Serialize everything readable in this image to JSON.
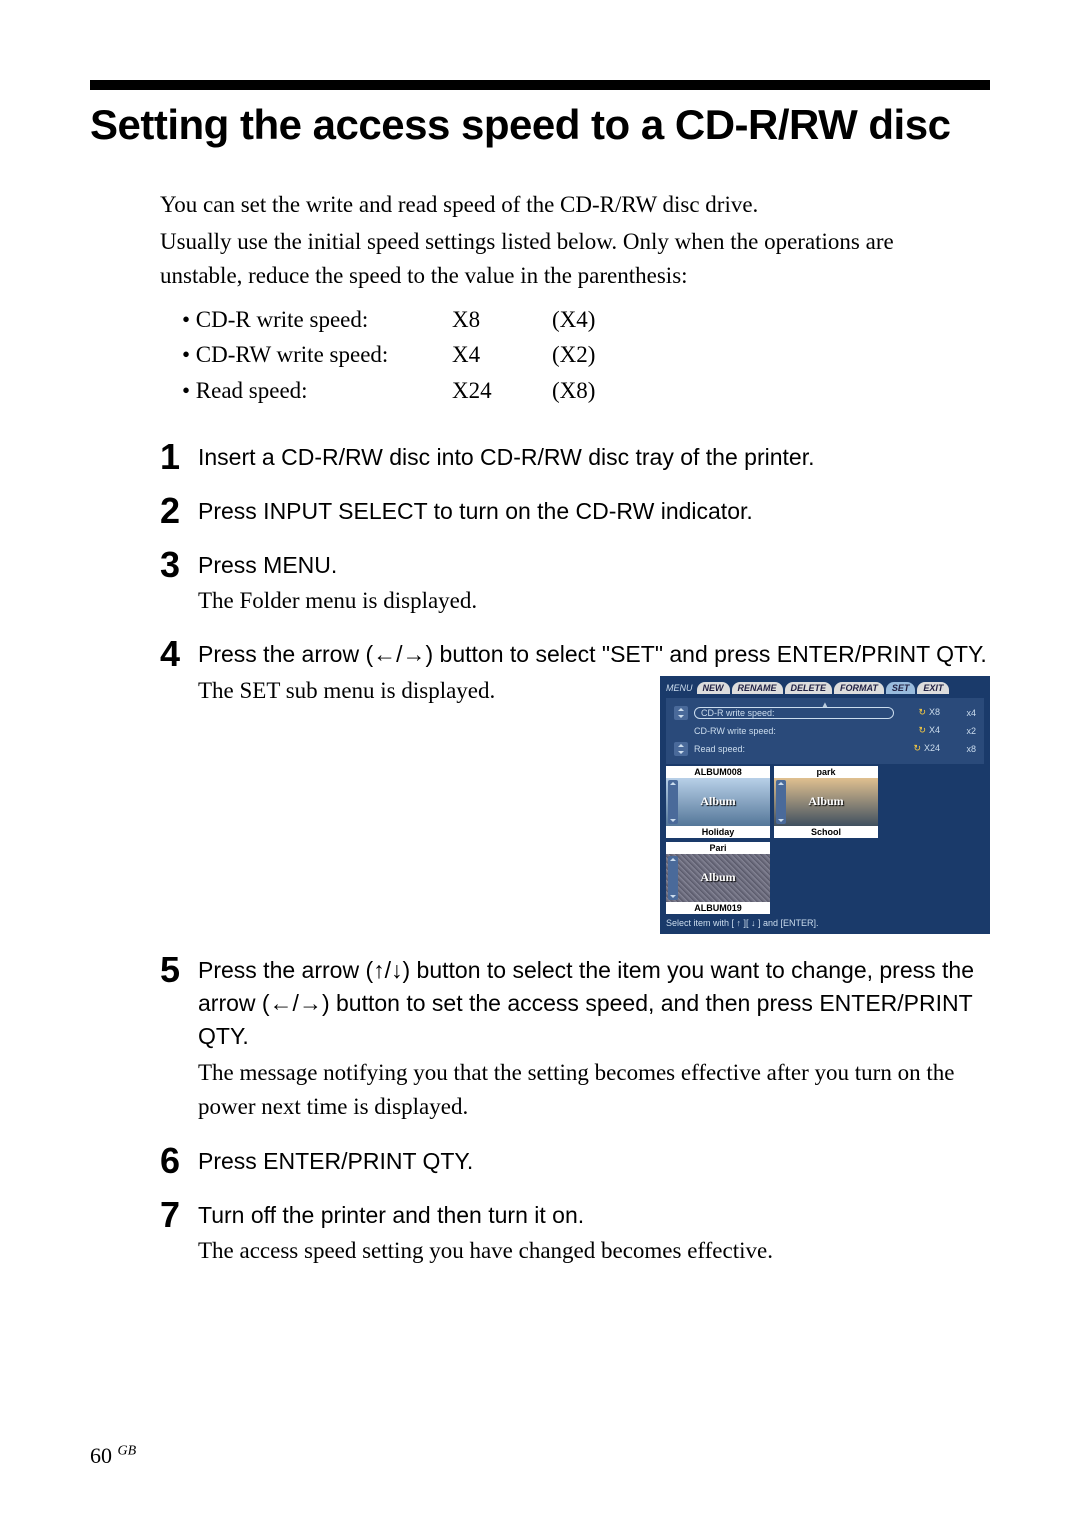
{
  "title": "Setting the access speed to a CD-R/RW disc",
  "intro": {
    "p1": "You can set the write and read speed of the CD-R/RW disc drive.",
    "p2": "Usually use the initial speed settings listed below.  Only when the operations are unstable, reduce the speed to the value in the parenthesis:"
  },
  "speed_rows": [
    {
      "label": "• CD-R write speed:",
      "initial": "X8",
      "alt": "(X4)"
    },
    {
      "label": "• CD-RW write speed:",
      "initial": "X4",
      "alt": "(X2)"
    },
    {
      "label": "• Read speed:",
      "initial": "X24",
      "alt": "(X8)"
    }
  ],
  "steps": {
    "s1": {
      "num": "1",
      "head": "Insert a CD-R/RW disc into CD-R/RW disc tray of the printer."
    },
    "s2": {
      "num": "2",
      "head": "Press INPUT SELECT to turn on the CD-RW indicator."
    },
    "s3": {
      "num": "3",
      "head": "Press MENU.",
      "desc": "The Folder menu is displayed."
    },
    "s4": {
      "num": "4",
      "head": "Press the arrow  (←/→) button to select \"SET\" and press ENTER/PRINT QTY.",
      "desc": "The SET sub menu is displayed."
    },
    "s5": {
      "num": "5",
      "head": "Press the arrow  (↑/↓) button to select the item you want to change, press the arrow  (←/→) button to set the access speed, and then press ENTER/PRINT QTY.",
      "desc": "The message notifying you that the setting becomes effective after you turn on the power next time is displayed."
    },
    "s6": {
      "num": "6",
      "head": "Press ENTER/PRINT QTY."
    },
    "s7": {
      "num": "7",
      "head": "Turn off the printer and then turn it on.",
      "desc": "The access speed setting you have changed becomes effective."
    }
  },
  "screenshot": {
    "menu_label": "MENU",
    "tabs": [
      "NEW",
      "RENAME",
      "DELETE",
      "FORMAT",
      "SET",
      "EXIT"
    ],
    "settings": [
      {
        "label": "CD-R write speed:",
        "v1": "X8",
        "v2": "x4",
        "oval": true
      },
      {
        "label": "CD-RW write speed:",
        "v1": "X4",
        "v2": "x2"
      },
      {
        "label": "Read speed:",
        "v1": "X24",
        "v2": "x8"
      }
    ],
    "albums_top": [
      {
        "label": "ALBUM008",
        "overlay": "Album"
      },
      {
        "label": "park",
        "overlay": "Album"
      },
      {
        "label": "Pari",
        "overlay": "Album"
      }
    ],
    "albums_bottom": [
      {
        "label": "Holiday"
      },
      {
        "label": "School"
      },
      {
        "label": "ALBUM019"
      }
    ],
    "help": "Select item with [ ↑ ][ ↓ ] and [ENTER]."
  },
  "page_number": "60",
  "page_region": "GB"
}
